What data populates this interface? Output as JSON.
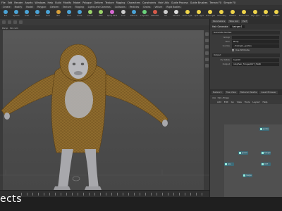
{
  "menubar": [
    "File",
    "Edit",
    "Render",
    "Assets",
    "Windows",
    "Help",
    "Build",
    "Modify",
    "Model",
    "Polygon",
    "Deform",
    "Texture",
    "Rigging",
    "Characters",
    "Constraints",
    "Hair Utils",
    "Guide Process",
    "Guide Brushes",
    "Terrain FX",
    "Simple FX"
  ],
  "shelf_tabs": [
    "Create",
    "Modify",
    "Model",
    "Polygon",
    "Deform",
    "Texture",
    "Rigging",
    "Lights and Cameras",
    "Collisions",
    "Particles",
    "Grains",
    "Vellum",
    "Rigid Bodies"
  ],
  "shelf_tools": [
    {
      "label": "Box",
      "color": "#4aa3d6"
    },
    {
      "label": "Sphere",
      "color": "#4aa3d6"
    },
    {
      "label": "Tube",
      "color": "#4aa3d6"
    },
    {
      "label": "Torus",
      "color": "#4aa3d6"
    },
    {
      "label": "Grid",
      "color": "#4aa3d6"
    },
    {
      "label": "Null",
      "color": "#d8a03a"
    },
    {
      "label": "Line",
      "color": "#4aa3d6"
    },
    {
      "label": "Circle",
      "color": "#4aa3d6"
    },
    {
      "label": "Curve",
      "color": "#9bd36a"
    },
    {
      "label": "Path",
      "color": "#9bd36a"
    },
    {
      "label": "Spray Paint",
      "color": "#d86ad3"
    },
    {
      "label": "Font",
      "color": "#cccccc"
    },
    {
      "label": "Platonic",
      "color": "#4aa3d6"
    },
    {
      "label": "L-System",
      "color": "#6ad37c"
    },
    {
      "label": "Metaball",
      "color": "#d65a4a"
    },
    {
      "label": "File",
      "color": "#cccccc"
    },
    {
      "label": "Camera",
      "color": "#dddddd"
    },
    {
      "label": "Point Light",
      "color": "#f0d54a"
    },
    {
      "label": "Spot Light",
      "color": "#f0d54a"
    },
    {
      "label": "Area Light",
      "color": "#f0d54a"
    },
    {
      "label": "Geometry",
      "color": "#f0d54a"
    },
    {
      "label": "Distant",
      "color": "#f0d54a"
    },
    {
      "label": "Environment",
      "color": "#f0d54a"
    },
    {
      "label": "Sky Light",
      "color": "#f0d54a"
    },
    {
      "label": "GI Light",
      "color": "#f0d54a"
    },
    {
      "label": "Caustic",
      "color": "#f0d54a"
    },
    {
      "label": "Portal",
      "color": "#f0d54a"
    }
  ],
  "viewport": {
    "subbar": [
      "Persp",
      "No cam"
    ]
  },
  "params": {
    "tabs": [
      "Parameters",
      "Take List",
      "Perf"
    ],
    "node_type": "Hair Generate",
    "node_name": "hairgen1",
    "section": "Generate Guides",
    "rows": [
      {
        "key": "Group",
        "value": ""
      },
      {
        "key": "Skin",
        "value": "Body"
      },
      {
        "key": "Guides",
        "value": "../hairgen_guides"
      }
    ],
    "checkbox": "Use Attribute",
    "section2": "Output",
    "rows2": [
      {
        "key": "UV Attrib",
        "value": "hairUV"
      },
      {
        "key": "Output",
        "value": "/obj/hair_fringe/OUT_HAIR"
      }
    ]
  },
  "network": {
    "tabs": [
      "Network",
      "Tree View",
      "Material Palette",
      "Asset Browser"
    ],
    "path": [
      "obj",
      "hair_fringe"
    ],
    "menu": [
      "Add",
      "Edit",
      "Go",
      "View",
      "Tools",
      "Layout",
      "Help"
    ],
    "nodes": [
      {
        "label": "guides",
        "color": "#3c6b78"
      },
      {
        "label": "groom",
        "color": "#3c6b78"
      },
      {
        "label": "hairgen",
        "color": "#3c6b78"
      },
      {
        "label": "skin",
        "color": "#3c6b78"
      },
      {
        "label": "OUT",
        "color": "#3c6b78"
      },
      {
        "label": "merge",
        "color": "#3c6b78"
      }
    ]
  },
  "colors": {
    "fur": "#7a5a24",
    "skin": "#b8b8bc",
    "accent": "#f0d54a"
  },
  "caption": "ects"
}
